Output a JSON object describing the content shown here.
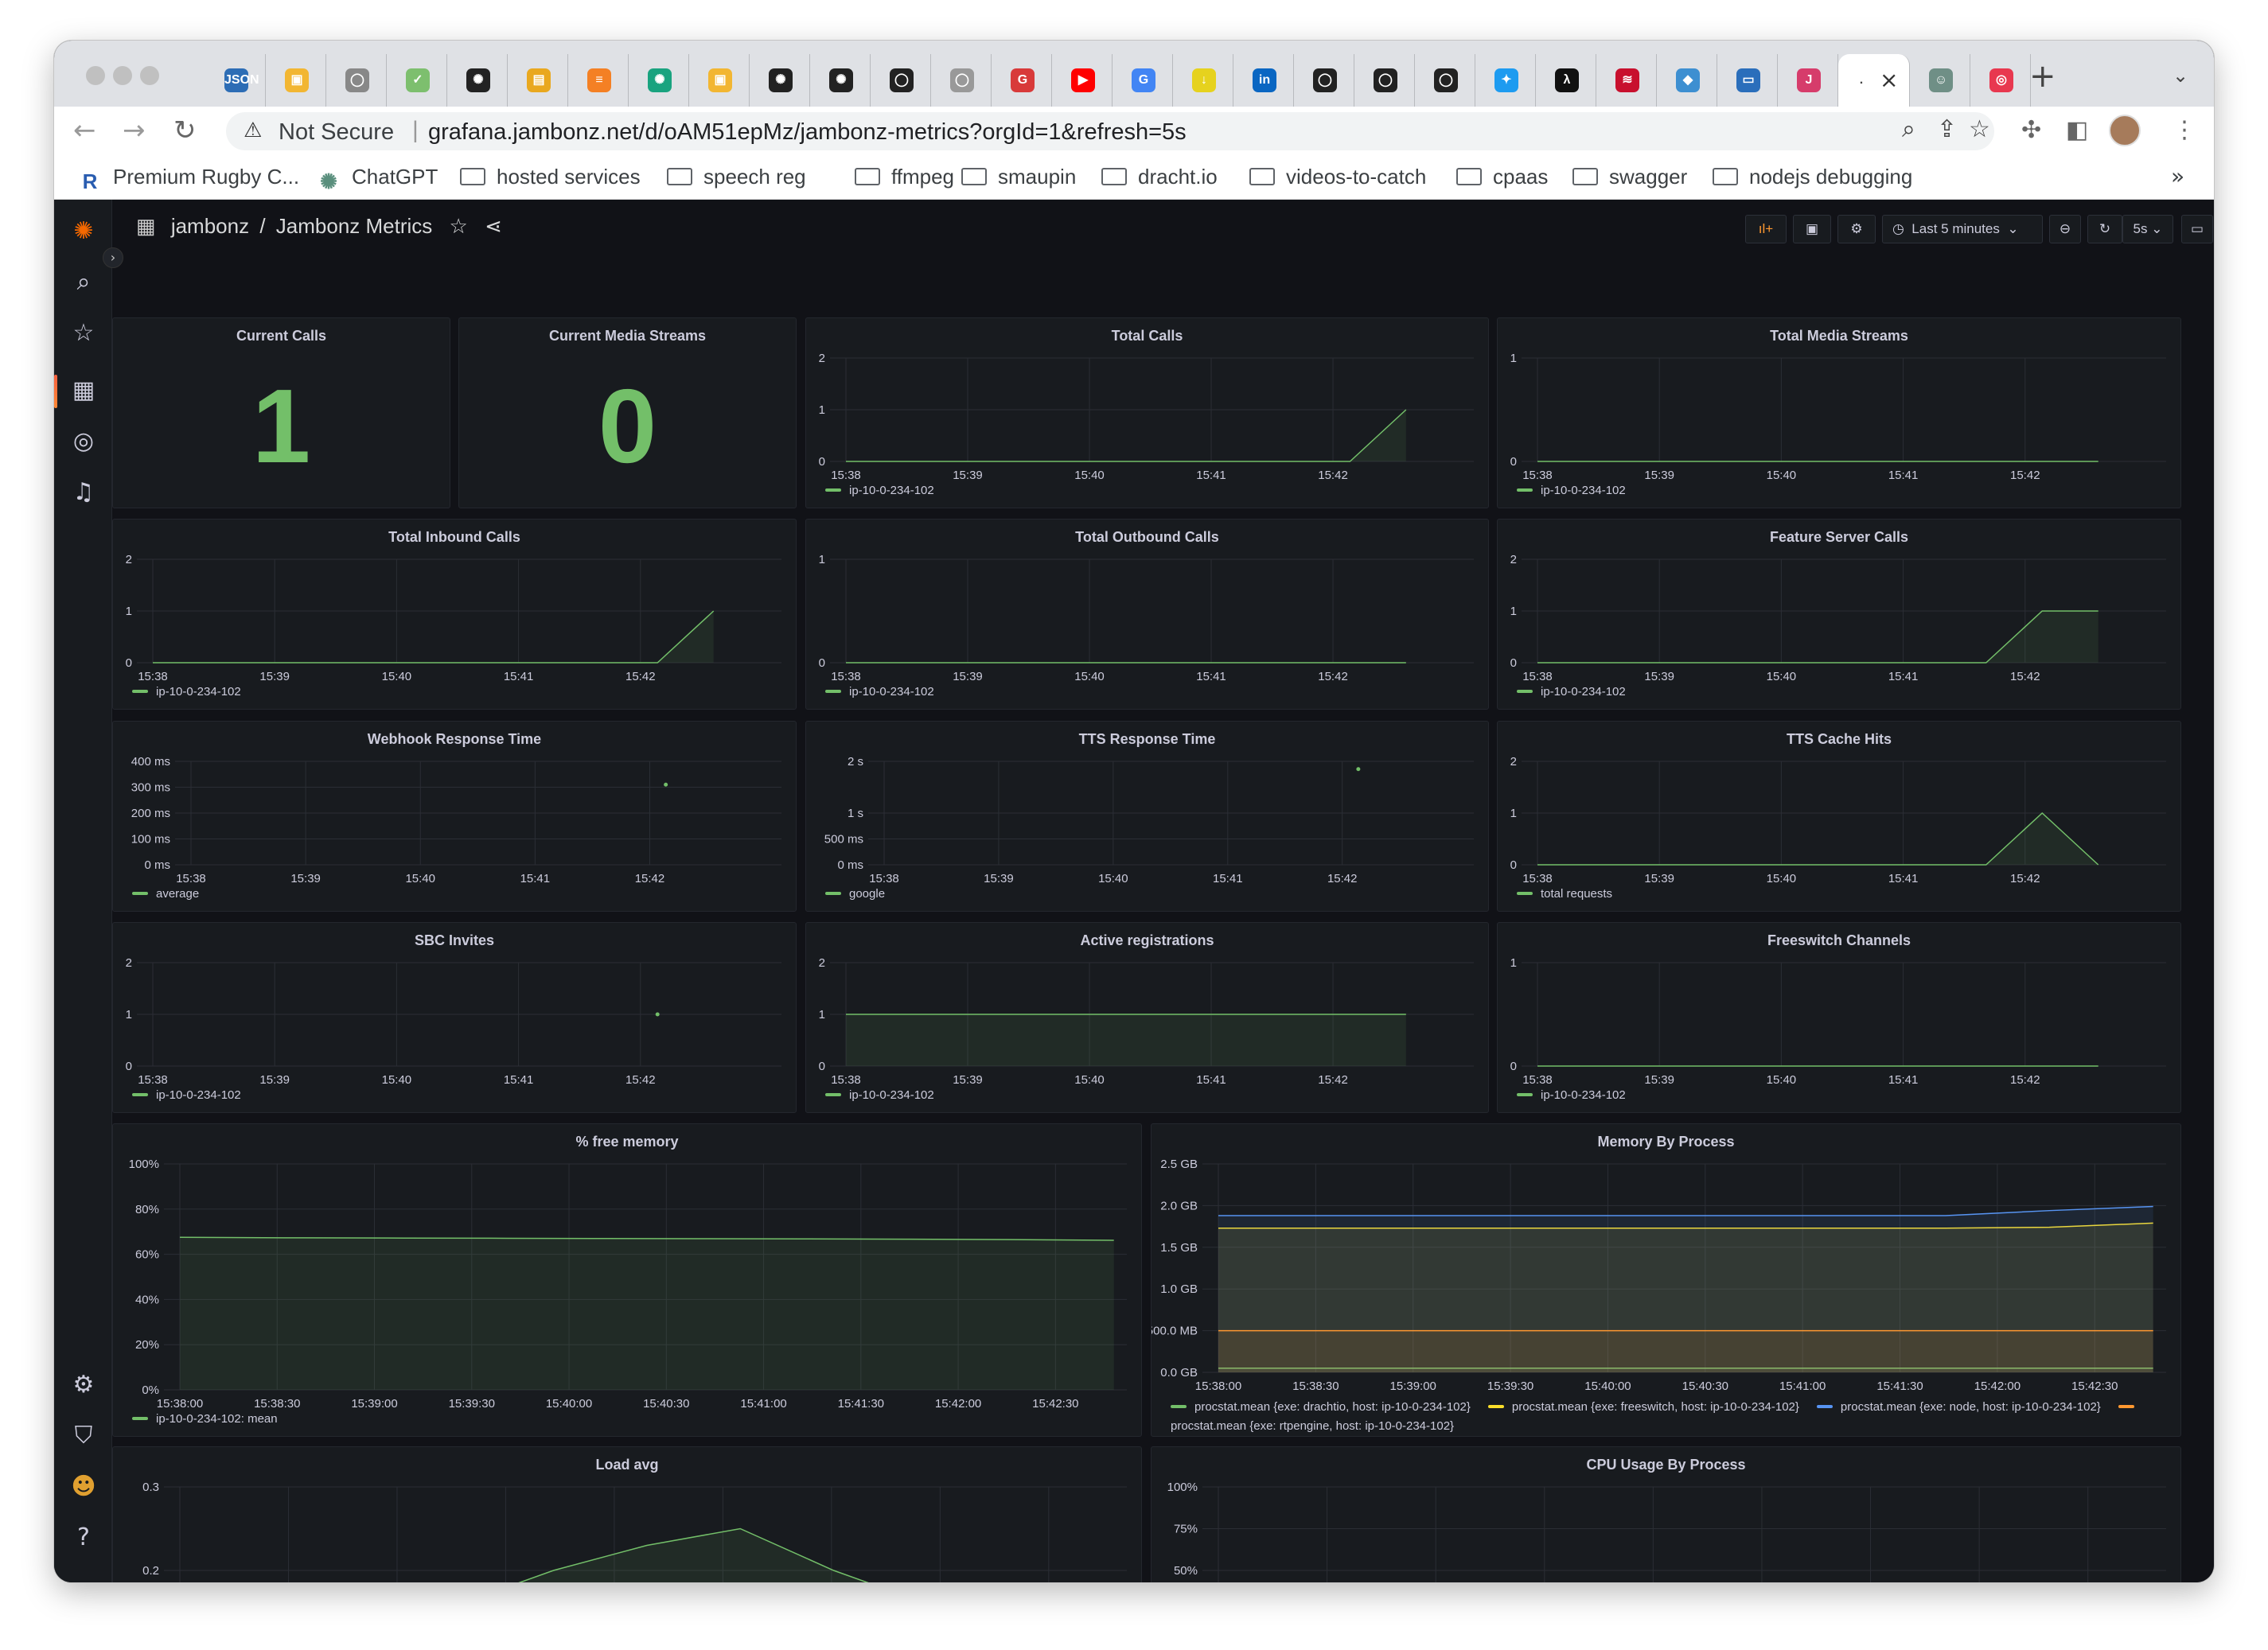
{
  "browser": {
    "tabs": [
      {
        "icon": "json-icon",
        "label": "JSON",
        "color": "#2d6db5"
      },
      {
        "icon": "box-icon",
        "label": "▣",
        "color": "#f2b632"
      },
      {
        "icon": "github-icon",
        "label": "◯",
        "color": "#888888"
      },
      {
        "icon": "check-icon",
        "label": "✓",
        "color": "#7dbf6e"
      },
      {
        "icon": "openai-icon",
        "label": "✺",
        "color": "#222222"
      },
      {
        "icon": "book-icon",
        "label": "▤",
        "color": "#e9a81f"
      },
      {
        "icon": "stack-icon",
        "label": "≡",
        "color": "#f48024"
      },
      {
        "icon": "openai-icon",
        "label": "✺",
        "color": "#19a37f"
      },
      {
        "icon": "box-icon",
        "label": "▣",
        "color": "#f2b632"
      },
      {
        "icon": "openai-icon",
        "label": "✺",
        "color": "#222222"
      },
      {
        "icon": "openai-icon",
        "label": "✺",
        "color": "#222222"
      },
      {
        "icon": "github-icon",
        "label": "◯",
        "color": "#222222"
      },
      {
        "icon": "github-icon",
        "label": "◯",
        "color": "#999999"
      },
      {
        "icon": "g-icon",
        "label": "G",
        "color": "#d83a3a"
      },
      {
        "icon": "youtube-icon",
        "label": "▶",
        "color": "#ff0000"
      },
      {
        "icon": "google-icon",
        "label": "G",
        "color": "#4285f4"
      },
      {
        "icon": "download-icon",
        "label": "↓",
        "color": "#e6d21e"
      },
      {
        "icon": "linkedin-icon",
        "label": "in",
        "color": "#0a66c2"
      },
      {
        "icon": "github-icon",
        "label": "◯",
        "color": "#222222"
      },
      {
        "icon": "github-icon",
        "label": "◯",
        "color": "#222222"
      },
      {
        "icon": "github-icon",
        "label": "◯",
        "color": "#222222"
      },
      {
        "icon": "twitter-icon",
        "label": "✦",
        "color": "#1d9bf0"
      },
      {
        "icon": "app-icon",
        "label": "λ",
        "color": "#111111"
      },
      {
        "icon": "flag-icon",
        "label": "≋",
        "color": "#c8102e"
      },
      {
        "icon": "dropbox-icon",
        "label": "◆",
        "color": "#3d8fd1"
      },
      {
        "icon": "monitor-icon",
        "label": "▭",
        "color": "#2a6ebb"
      },
      {
        "icon": "j-icon",
        "label": "J",
        "color": "#d63c6b"
      },
      {
        "icon": "dot-icon",
        "label": ".",
        "color": "#555555"
      },
      {
        "icon": "cat-icon",
        "label": "☺",
        "color": "#6f8f86"
      },
      {
        "icon": "lifebuoy-icon",
        "label": "◎",
        "color": "#e8384f"
      }
    ],
    "active_tab_label": ".",
    "new_tab": "+",
    "tab_menu": "⌄",
    "not_secure": "Not Secure",
    "url_sep": "|",
    "url": "grafana.jambonz.net/d/oAM51epMz/jambonz-metrics?orgId=1&refresh=5s",
    "bookmarks": [
      {
        "label": "Premium Rugby C...",
        "type": "icon",
        "icon": "rugby-icon"
      },
      {
        "label": "ChatGPT",
        "type": "icon",
        "icon": "openai-icon"
      },
      {
        "label": "hosted services",
        "type": "folder"
      },
      {
        "label": "speech reg",
        "type": "folder"
      },
      {
        "label": "ffmpeg",
        "type": "folder"
      },
      {
        "label": "smaupin",
        "type": "folder"
      },
      {
        "label": "dracht.io",
        "type": "folder"
      },
      {
        "label": "videos-to-catch",
        "type": "folder"
      },
      {
        "label": "cpaas",
        "type": "folder"
      },
      {
        "label": "swagger",
        "type": "folder"
      },
      {
        "label": "nodejs debugging",
        "type": "folder"
      }
    ],
    "bookmarks_more": "»"
  },
  "grafana": {
    "breadcrumb_folder": "jambonz",
    "breadcrumb_sep": "/",
    "breadcrumb_title": "Jambonz Metrics",
    "time_range": "Last 5 minutes",
    "refresh_interval": "5s",
    "accent_color": "#73bf69"
  },
  "panels": {
    "current_calls": {
      "title": "Current Calls",
      "value": "1"
    },
    "current_media_streams": {
      "title": "Current Media Streams",
      "value": "0"
    },
    "total_calls": {
      "title": "Total Calls",
      "legend": "ip-10-0-234-102"
    },
    "total_media_streams": {
      "title": "Total Media Streams",
      "legend": "ip-10-0-234-102"
    },
    "total_inbound_calls": {
      "title": "Total Inbound Calls",
      "legend": "ip-10-0-234-102"
    },
    "total_outbound_calls": {
      "title": "Total Outbound Calls",
      "legend": "ip-10-0-234-102"
    },
    "feature_server_calls": {
      "title": "Feature Server Calls",
      "legend": "ip-10-0-234-102"
    },
    "webhook_response_time": {
      "title": "Webhook Response Time",
      "legend": "average"
    },
    "tts_response_time": {
      "title": "TTS Response Time",
      "legend": "google"
    },
    "tts_cache_hits": {
      "title": "TTS Cache Hits",
      "legend": "total requests"
    },
    "sbc_invites": {
      "title": "SBC Invites",
      "legend": "ip-10-0-234-102"
    },
    "active_registrations": {
      "title": "Active registrations",
      "legend": "ip-10-0-234-102"
    },
    "freeswitch_channels": {
      "title": "Freeswitch Channels",
      "legend": "ip-10-0-234-102"
    },
    "free_memory": {
      "title": "% free memory",
      "legend": "ip-10-0-234-102: mean"
    },
    "memory_by_process": {
      "title": "Memory By Process",
      "legend": [
        {
          "label": "procstat.mean {exe: drachtio, host: ip-10-0-234-102}",
          "color": "#73bf69"
        },
        {
          "label": "procstat.mean {exe: freeswitch, host: ip-10-0-234-102}",
          "color": "#fade2a"
        },
        {
          "label": "procstat.mean {exe: node, host: ip-10-0-234-102}",
          "color": "#5794f2"
        },
        {
          "label": "procstat.mean {exe: rtpengine, host: ip-10-0-234-102}",
          "color": "#ff9830"
        }
      ]
    },
    "load_avg": {
      "title": "Load avg"
    },
    "cpu_usage": {
      "title": "CPU Usage By Process"
    }
  },
  "chart_data": [
    {
      "id": "total_calls",
      "type": "line",
      "x": [
        "15:38",
        "15:38:30",
        "15:39",
        "15:39:30",
        "15:40",
        "15:40:30",
        "15:41",
        "15:41:30",
        "15:42",
        "15:42:30",
        "15:42:45"
      ],
      "x_ticks": [
        "15:38",
        "15:39",
        "15:40",
        "15:41",
        "15:42"
      ],
      "y_ticks": [
        "0",
        "1",
        "2"
      ],
      "ylim": [
        0,
        2
      ],
      "series": [
        {
          "name": "ip-10-0-234-102",
          "values": [
            0,
            0,
            0,
            0,
            0,
            0,
            0,
            0,
            0,
            0,
            1
          ]
        }
      ]
    },
    {
      "id": "total_media_streams",
      "type": "line",
      "x_ticks": [
        "15:38",
        "15:39",
        "15:40",
        "15:41",
        "15:42"
      ],
      "y_ticks": [
        "0",
        "1"
      ],
      "ylim": [
        0,
        1
      ],
      "series": [
        {
          "name": "ip-10-0-234-102",
          "values": [
            0,
            0,
            0,
            0,
            0,
            0,
            0,
            0,
            0,
            0,
            0
          ]
        }
      ]
    },
    {
      "id": "total_inbound_calls",
      "type": "line",
      "x_ticks": [
        "15:38",
        "15:39",
        "15:40",
        "15:41",
        "15:42"
      ],
      "y_ticks": [
        "0",
        "1",
        "2"
      ],
      "ylim": [
        0,
        2
      ],
      "series": [
        {
          "name": "ip-10-0-234-102",
          "values": [
            0,
            0,
            0,
            0,
            0,
            0,
            0,
            0,
            0,
            0,
            1
          ]
        }
      ]
    },
    {
      "id": "total_outbound_calls",
      "type": "line",
      "x_ticks": [
        "15:38",
        "15:39",
        "15:40",
        "15:41",
        "15:42"
      ],
      "y_ticks": [
        "0",
        "1"
      ],
      "ylim": [
        0,
        1
      ],
      "series": [
        {
          "name": "ip-10-0-234-102",
          "values": [
            0,
            0,
            0,
            0,
            0,
            0,
            0,
            0,
            0,
            0,
            0
          ]
        }
      ]
    },
    {
      "id": "feature_server_calls",
      "type": "line",
      "x_ticks": [
        "15:38",
        "15:39",
        "15:40",
        "15:41",
        "15:42"
      ],
      "y_ticks": [
        "0",
        "1",
        "2"
      ],
      "ylim": [
        0,
        2
      ],
      "series": [
        {
          "name": "ip-10-0-234-102",
          "values": [
            0,
            0,
            0,
            0,
            0,
            0,
            0,
            0,
            0,
            1,
            1
          ]
        }
      ]
    },
    {
      "id": "webhook_response_time",
      "type": "scatter",
      "x_ticks": [
        "15:38",
        "15:39",
        "15:40",
        "15:41",
        "15:42"
      ],
      "y_ticks": [
        "0 ms",
        "100 ms",
        "200 ms",
        "300 ms",
        "400 ms"
      ],
      "ylim": [
        0,
        400
      ],
      "series": [
        {
          "name": "average",
          "values": [
            null,
            null,
            null,
            null,
            null,
            null,
            null,
            null,
            null,
            310,
            null
          ]
        }
      ]
    },
    {
      "id": "tts_response_time",
      "type": "scatter",
      "x_ticks": [
        "15:38",
        "15:39",
        "15:40",
        "15:41",
        "15:42"
      ],
      "y_ticks": [
        "0 ms",
        "500 ms",
        "1 s",
        "2 s"
      ],
      "ylim": [
        0,
        2000
      ],
      "series": [
        {
          "name": "google",
          "values": [
            null,
            null,
            null,
            null,
            null,
            null,
            null,
            null,
            null,
            1850,
            null
          ]
        }
      ]
    },
    {
      "id": "tts_cache_hits",
      "type": "line",
      "x_ticks": [
        "15:38",
        "15:39",
        "15:40",
        "15:41",
        "15:42"
      ],
      "y_ticks": [
        "0",
        "1",
        "2"
      ],
      "ylim": [
        0,
        2
      ],
      "series": [
        {
          "name": "total requests",
          "values": [
            0,
            0,
            0,
            0,
            0,
            0,
            0,
            0,
            0,
            1,
            0
          ]
        }
      ]
    },
    {
      "id": "sbc_invites",
      "type": "scatter",
      "x_ticks": [
        "15:38",
        "15:39",
        "15:40",
        "15:41",
        "15:42"
      ],
      "y_ticks": [
        "0",
        "1",
        "2"
      ],
      "ylim": [
        0,
        2
      ],
      "series": [
        {
          "name": "ip-10-0-234-102",
          "values": [
            null,
            null,
            null,
            null,
            null,
            null,
            null,
            null,
            null,
            1,
            null
          ]
        }
      ]
    },
    {
      "id": "active_registrations",
      "type": "line",
      "x_ticks": [
        "15:38",
        "15:39",
        "15:40",
        "15:41",
        "15:42"
      ],
      "y_ticks": [
        "0",
        "1",
        "2"
      ],
      "ylim": [
        0,
        2
      ],
      "series": [
        {
          "name": "ip-10-0-234-102",
          "values": [
            1,
            1,
            1,
            1,
            1,
            1,
            1,
            1,
            1,
            1,
            1
          ]
        }
      ]
    },
    {
      "id": "freeswitch_channels",
      "type": "line",
      "x_ticks": [
        "15:38",
        "15:39",
        "15:40",
        "15:41",
        "15:42"
      ],
      "y_ticks": [
        "0",
        "1"
      ],
      "ylim": [
        0,
        1
      ],
      "series": [
        {
          "name": "ip-10-0-234-102",
          "values": [
            0,
            0,
            0,
            0,
            0,
            0,
            0,
            0,
            0,
            0,
            0
          ]
        }
      ]
    },
    {
      "id": "free_memory",
      "type": "area",
      "x_ticks": [
        "15:38:00",
        "15:38:30",
        "15:39:00",
        "15:39:30",
        "15:40:00",
        "15:40:30",
        "15:41:00",
        "15:41:30",
        "15:42:00",
        "15:42:30"
      ],
      "y_ticks": [
        "0%",
        "20%",
        "40%",
        "60%",
        "80%",
        "100%"
      ],
      "ylim": [
        0,
        100
      ],
      "series": [
        {
          "name": "ip-10-0-234-102: mean",
          "values": [
            67.5,
            67.3,
            67.2,
            67.1,
            67.0,
            66.9,
            66.8,
            66.7,
            66.5,
            66.2
          ]
        }
      ]
    },
    {
      "id": "memory_by_process",
      "type": "area",
      "x_ticks": [
        "15:38:00",
        "15:38:30",
        "15:39:00",
        "15:39:30",
        "15:40:00",
        "15:40:30",
        "15:41:00",
        "15:41:30",
        "15:42:00",
        "15:42:30"
      ],
      "y_ticks": [
        "0.0 GB",
        "500.0 MB",
        "1.0 GB",
        "1.5 GB",
        "2.0 GB",
        "2.5 GB"
      ],
      "ylim": [
        0,
        2.5
      ],
      "series": [
        {
          "name": "procstat.mean {exe: drachtio, host: ip-10-0-234-102}",
          "values": [
            0.05,
            0.05,
            0.05,
            0.05,
            0.05,
            0.05,
            0.05,
            0.05,
            0.05,
            0.05
          ]
        },
        {
          "name": "procstat.mean {exe: freeswitch, host: ip-10-0-234-102}",
          "values": [
            1.73,
            1.73,
            1.73,
            1.73,
            1.73,
            1.73,
            1.73,
            1.73,
            1.74,
            1.79
          ]
        },
        {
          "name": "procstat.mean {exe: node, host: ip-10-0-234-102}",
          "values": [
            1.88,
            1.88,
            1.88,
            1.88,
            1.88,
            1.88,
            1.88,
            1.88,
            1.94,
            1.99
          ]
        },
        {
          "name": "procstat.mean {exe: rtpengine, host: ip-10-0-234-102}",
          "values": [
            0.5,
            0.5,
            0.5,
            0.5,
            0.5,
            0.5,
            0.5,
            0.5,
            0.5,
            0.5
          ]
        }
      ]
    },
    {
      "id": "load_avg",
      "type": "area",
      "y_ticks": [
        "0.2",
        "0.3"
      ],
      "ylim": [
        0.1,
        0.3
      ],
      "series": [
        {
          "name": "",
          "values": [
            0.13,
            0.14,
            0.12,
            0.16,
            0.2,
            0.23,
            0.25,
            0.2,
            0.16,
            0.13,
            0.11
          ]
        }
      ]
    },
    {
      "id": "cpu_usage",
      "type": "area",
      "y_ticks": [
        "50%",
        "75%",
        "100%"
      ],
      "ylim": [
        0,
        100
      ],
      "series": []
    }
  ]
}
